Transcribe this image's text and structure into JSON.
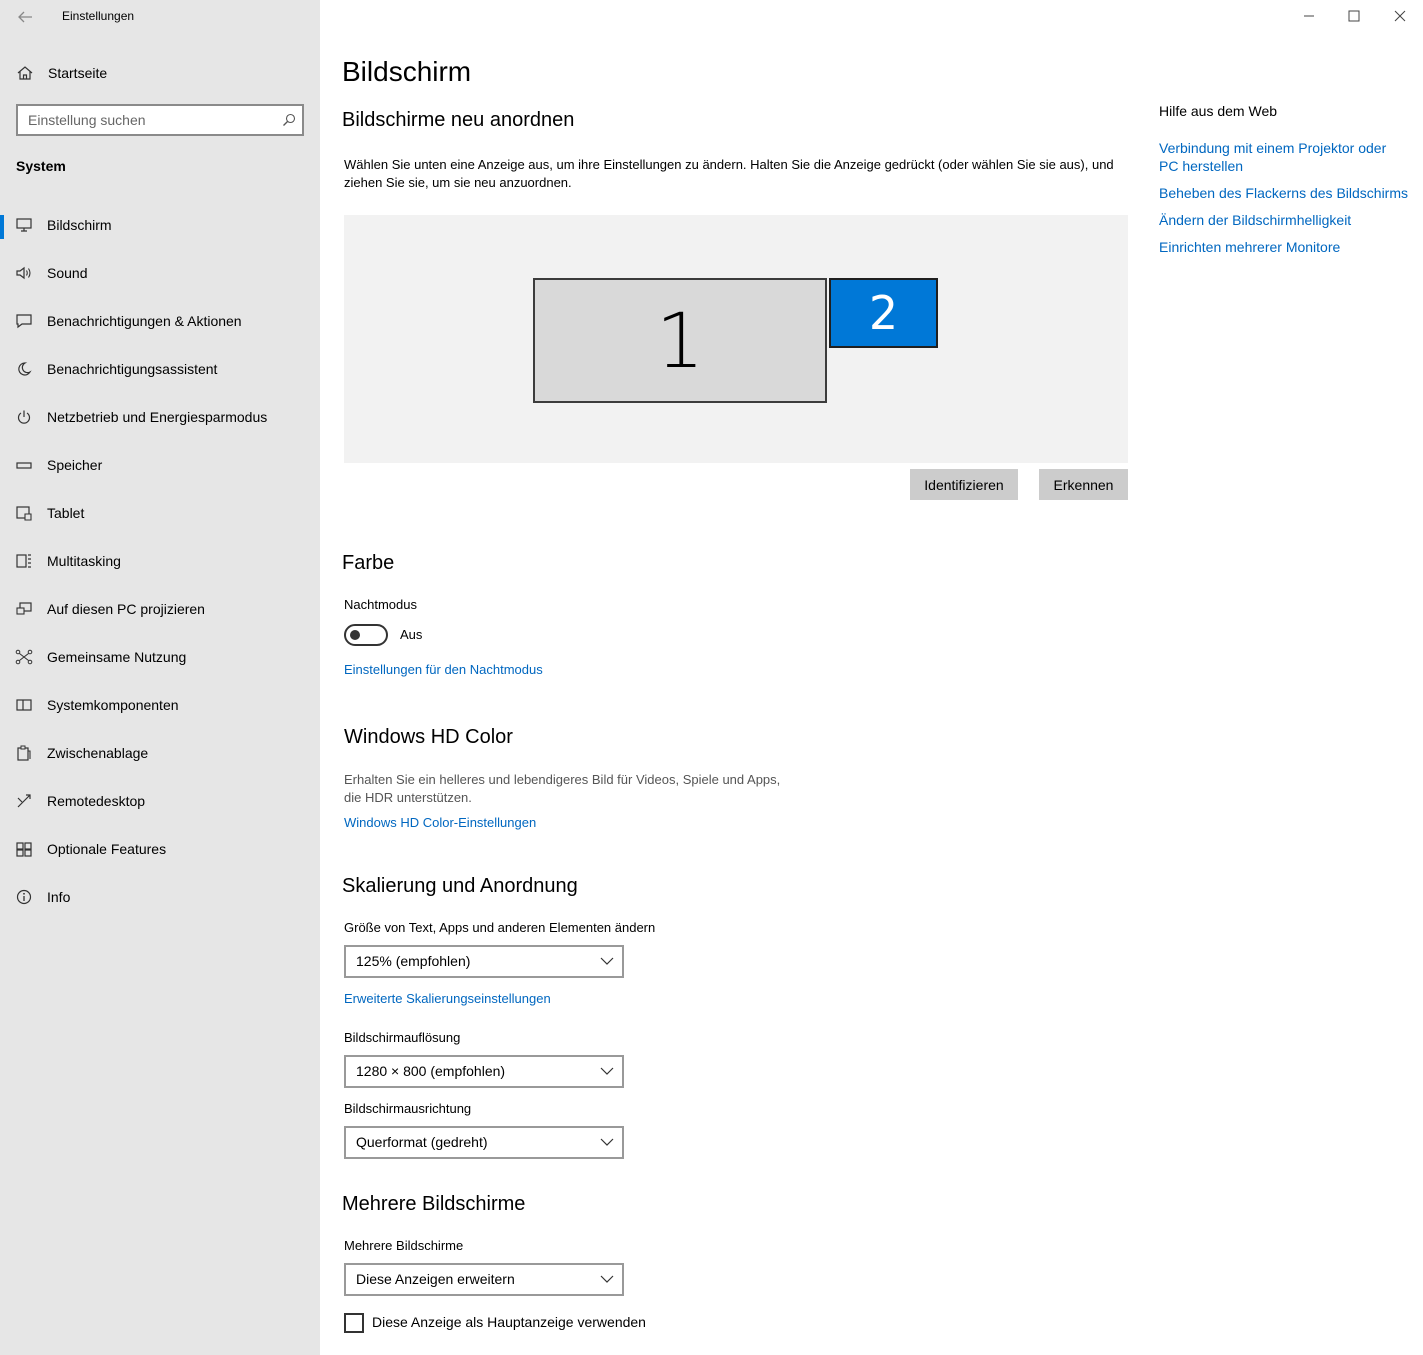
{
  "app": {
    "title": "Einstellungen"
  },
  "sidebar": {
    "home_label": "Startseite",
    "search_placeholder": "Einstellung suchen",
    "section": "System",
    "items": [
      {
        "label": "Bildschirm",
        "icon": "monitor-icon"
      },
      {
        "label": "Sound",
        "icon": "speaker-icon"
      },
      {
        "label": "Benachrichtigungen & Aktionen",
        "icon": "message-icon"
      },
      {
        "label": "Benachrichtigungsassistent",
        "icon": "moon-icon"
      },
      {
        "label": "Netzbetrieb und Energiesparmodus",
        "icon": "power-icon"
      },
      {
        "label": "Speicher",
        "icon": "storage-icon"
      },
      {
        "label": "Tablet",
        "icon": "tablet-icon"
      },
      {
        "label": "Multitasking",
        "icon": "multitasking-icon"
      },
      {
        "label": "Auf diesen PC projizieren",
        "icon": "project-icon"
      },
      {
        "label": "Gemeinsame Nutzung",
        "icon": "share-icon"
      },
      {
        "label": "Systemkomponenten",
        "icon": "components-icon"
      },
      {
        "label": "Zwischenablage",
        "icon": "clipboard-icon"
      },
      {
        "label": "Remotedesktop",
        "icon": "remote-icon"
      },
      {
        "label": "Optionale Features",
        "icon": "features-icon"
      },
      {
        "label": "Info",
        "icon": "info-icon"
      }
    ]
  },
  "main": {
    "title": "Bildschirm",
    "arrange": {
      "heading": "Bildschirme neu anordnen",
      "description": "Wählen Sie unten eine Anzeige aus, um ihre Einstellungen zu ändern. Halten Sie die Anzeige gedrückt (oder wählen Sie sie aus), und ziehen Sie sie, um sie neu anzuordnen.",
      "monitor1": "1",
      "monitor2": "2",
      "identify_label": "Identifizieren",
      "detect_label": "Erkennen"
    },
    "color": {
      "heading": "Farbe",
      "night_label": "Nachtmodus",
      "night_state": "Aus",
      "night_link": "Einstellungen für den Nachtmodus"
    },
    "hdr": {
      "heading": "Windows HD Color",
      "description": "Erhalten Sie ein helleres und lebendigeres Bild für Videos, Spiele und Apps, die HDR unterstützen.",
      "link": "Windows HD Color-Einstellungen"
    },
    "scale": {
      "heading": "Skalierung und Anordnung",
      "size_label": "Größe von Text, Apps und anderen Elementen ändern",
      "size_value": "125% (empfohlen)",
      "advanced_link": "Erweiterte Skalierungseinstellungen",
      "resolution_label": "Bildschirmauflösung",
      "resolution_value": "1280 × 800 (empfohlen)",
      "orientation_label": "Bildschirmausrichtung",
      "orientation_value": "Querformat (gedreht)"
    },
    "multi": {
      "heading": "Mehrere Bildschirme",
      "label": "Mehrere Bildschirme",
      "value": "Diese Anzeigen erweitern",
      "checkbox_label": "Diese Anzeige als Hauptanzeige verwenden"
    }
  },
  "help": {
    "title": "Hilfe aus dem Web",
    "links": [
      "Verbindung mit einem Projektor oder PC herstellen",
      "Beheben des Flackerns des Bildschirms",
      "Ändern der Bildschirmhelligkeit",
      "Einrichten mehrerer Monitore"
    ]
  },
  "colors": {
    "accent": "#0078d7",
    "link": "#0067c0",
    "sidebar_bg": "#e6e6e6"
  }
}
